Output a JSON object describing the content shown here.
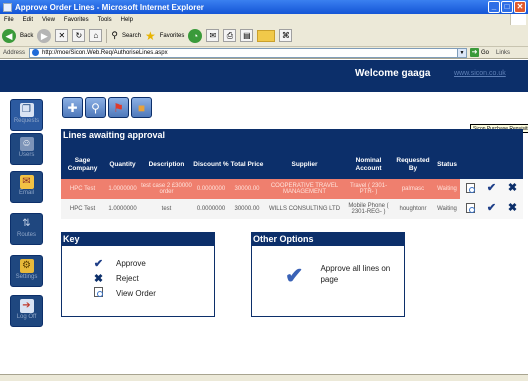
{
  "window": {
    "title": "Approve Order Lines - Microsoft Internet Explorer"
  },
  "menu": [
    "File",
    "Edit",
    "View",
    "Favorites",
    "Tools",
    "Help"
  ],
  "toolbar": {
    "back": "Back",
    "search": "Search",
    "favorites": "Favorites"
  },
  "address": {
    "label": "Address",
    "url": "http://moe/Sicon.Web.Req/AuthoriseLines.aspx",
    "go": "Go",
    "links": "Links"
  },
  "header": {
    "welcome": "Welcome gaaga",
    "site": "www.sicon.co.uk"
  },
  "sidebar": [
    {
      "label": "Requests",
      "icon": "requests-icon"
    },
    {
      "label": "Users",
      "icon": "users-icon"
    },
    {
      "label": "Email",
      "icon": "email-icon"
    },
    {
      "label": "Routes",
      "icon": "routes-icon"
    },
    {
      "label": "Settings",
      "icon": "settings-icon"
    },
    {
      "label": "Log Off",
      "icon": "log-off-icon"
    }
  ],
  "tooltip": "Sicon Purchase Requisition System",
  "lines": {
    "title": "Lines awaiting approval",
    "columns": [
      "Sage Company",
      "Quantity",
      "Description",
      "Discount %",
      "Total Price",
      "Supplier",
      "Nominal Account",
      "Requested By",
      "Status"
    ],
    "rows": [
      {
        "company": "HPC Test",
        "quantity": "1.0000000",
        "description": "test case 2 £30000 order",
        "discount": "0.0000000",
        "total": "30000.00",
        "supplier": "COOPERATIVE TRAVEL MANAGEMENT",
        "nominal": "Travel ( 2301-PTR- )",
        "requested_by": "palmasc",
        "status": "Waiting"
      },
      {
        "company": "HPC Test",
        "quantity": "1.0000000",
        "description": "test",
        "discount": "0.0000000",
        "total": "30000.00",
        "supplier": "WILLS CONSULTING LTD",
        "nominal": "Mobile Phone ( 2301-REG- )",
        "requested_by": "houghtonr",
        "status": "Waiting"
      }
    ]
  },
  "key": {
    "title": "Key",
    "items": [
      {
        "icon": "approve-tick-icon",
        "label": "Approve"
      },
      {
        "icon": "reject-cross-icon",
        "label": "Reject"
      },
      {
        "icon": "view-order-icon",
        "label": "View Order"
      }
    ]
  },
  "options": {
    "title": "Other Options",
    "approve_all": "Approve all lines on page"
  },
  "colors": {
    "navy": "#0c2f6a",
    "highlight_row": "#ef7f6e"
  }
}
